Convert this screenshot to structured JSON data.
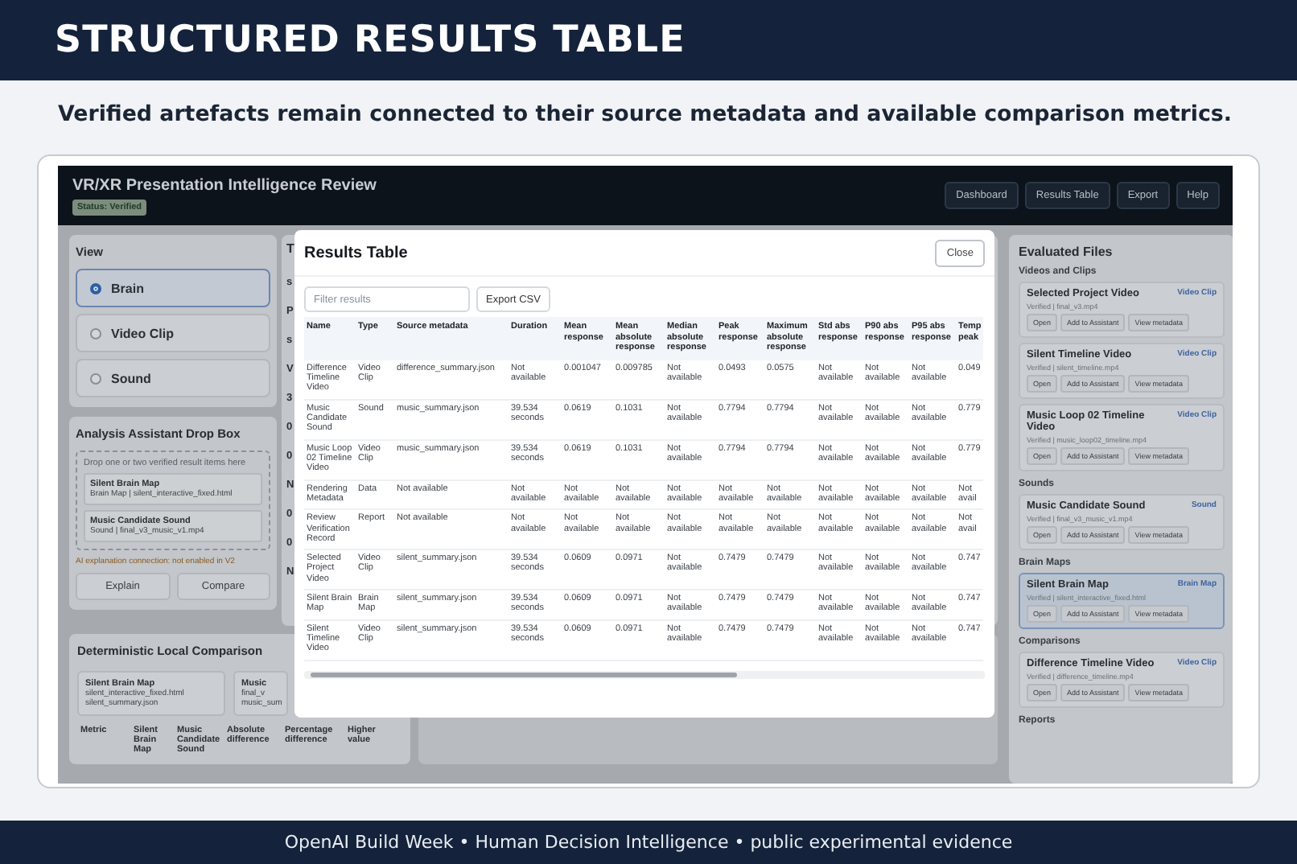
{
  "header": {
    "title": "STRUCTURED RESULTS TABLE"
  },
  "subtitle": "Verified artefacts remain connected to their source metadata and available comparison metrics.",
  "app": {
    "title": "VR/XR Presentation Intelligence Review",
    "status": "Status: Verified",
    "nav": [
      "Dashboard",
      "Results Table",
      "Export",
      "Help"
    ]
  },
  "view_panel": {
    "title": "View",
    "options": [
      {
        "label": "Brain",
        "selected": true
      },
      {
        "label": "Video Clip",
        "selected": false
      },
      {
        "label": "Sound",
        "selected": false
      }
    ]
  },
  "assistant": {
    "title": "Analysis Assistant Drop Box",
    "hint": "Drop one or two verified result items here",
    "items": [
      {
        "name": "Silent Brain Map",
        "detail": "Brain Map | silent_interactive_fixed.html"
      },
      {
        "name": "Music Candidate Sound",
        "detail": "Sound | final_v3_music_v1.mp4"
      }
    ],
    "notice": "AI explanation connection: not enabled in V2",
    "buttons": [
      "Explain",
      "Compare"
    ]
  },
  "comparison": {
    "title": "Deterministic Local Comparison",
    "cards": [
      {
        "name": "Silent Brain Map",
        "lines": [
          "silent_interactive_fixed.html",
          "silent_summary.json"
        ]
      },
      {
        "name": "Music",
        "lines": [
          "final_v",
          "music_sum"
        ]
      }
    ],
    "columns": [
      "Metric",
      "Silent Brain Map",
      "Music Candidate Sound",
      "Absolute difference",
      "Percentage difference",
      "Higher value"
    ]
  },
  "middle_panel": {
    "title": "T",
    "values": [
      "s",
      "P",
      "s",
      "V",
      "3",
      "0",
      "0",
      "N",
      "0",
      "0",
      "N"
    ]
  },
  "modal": {
    "title": "Results Table",
    "close": "Close",
    "filter": {
      "placeholder": "Filter results"
    },
    "export": "Export CSV",
    "columns": [
      "Name",
      "Type",
      "Source metadata",
      "Duration",
      "Mean response",
      "Mean absolute response",
      "Median absolute response",
      "Peak response",
      "Maximum absolute response",
      "Std abs response",
      "P90 abs response",
      "P95 abs response",
      "Temp peak"
    ],
    "rows": [
      [
        "Difference Timeline Video",
        "Video Clip",
        "difference_summary.json",
        "Not available",
        "0.001047",
        "0.009785",
        "Not available",
        "0.0493",
        "0.0575",
        "Not available",
        "Not available",
        "Not available",
        "0.049"
      ],
      [
        "Music Candidate Sound",
        "Sound",
        "music_summary.json",
        "39.534 seconds",
        "0.0619",
        "0.1031",
        "Not available",
        "0.7794",
        "0.7794",
        "Not available",
        "Not available",
        "Not available",
        "0.779"
      ],
      [
        "Music Loop 02 Timeline Video",
        "Video Clip",
        "music_summary.json",
        "39.534 seconds",
        "0.0619",
        "0.1031",
        "Not available",
        "0.7794",
        "0.7794",
        "Not available",
        "Not available",
        "Not available",
        "0.779"
      ],
      [
        "Rendering Metadata",
        "Data",
        "Not available",
        "Not available",
        "Not available",
        "Not available",
        "Not available",
        "Not available",
        "Not available",
        "Not available",
        "Not available",
        "Not available",
        "Not avail"
      ],
      [
        "Review Verification Record",
        "Report",
        "Not available",
        "Not available",
        "Not available",
        "Not available",
        "Not available",
        "Not available",
        "Not available",
        "Not available",
        "Not available",
        "Not available",
        "Not avail"
      ],
      [
        "Selected Project Video",
        "Video Clip",
        "silent_summary.json",
        "39.534 seconds",
        "0.0609",
        "0.0971",
        "Not available",
        "0.7479",
        "0.7479",
        "Not available",
        "Not available",
        "Not available",
        "0.747"
      ],
      [
        "Silent Brain Map",
        "Brain Map",
        "silent_summary.json",
        "39.534 seconds",
        "0.0609",
        "0.0971",
        "Not available",
        "0.7479",
        "0.7479",
        "Not available",
        "Not available",
        "Not available",
        "0.747"
      ],
      [
        "Silent Timeline Video",
        "Video Clip",
        "silent_summary.json",
        "39.534 seconds",
        "0.0609",
        "0.0971",
        "Not available",
        "0.7479",
        "0.7479",
        "Not available",
        "Not available",
        "Not available",
        "0.747"
      ]
    ]
  },
  "files": {
    "title": "Evaluated Files",
    "groups": [
      {
        "label": "Videos and Clips",
        "items": [
          {
            "name": "Selected Project Video",
            "tag": "Video Clip",
            "detail": "Verified | final_v3.mp4",
            "selected": false,
            "actions": [
              "Open",
              "Add to Assistant",
              "View metadata"
            ]
          },
          {
            "name": "Silent Timeline Video",
            "tag": "Video Clip",
            "detail": "Verified | silent_timeline.mp4",
            "selected": false,
            "actions": [
              "Open",
              "Add to Assistant",
              "View metadata"
            ]
          },
          {
            "name": "Music Loop 02 Timeline Video",
            "tag": "Video Clip",
            "detail": "Verified | music_loop02_timeline.mp4",
            "selected": false,
            "actions": [
              "Open",
              "Add to Assistant",
              "View metadata"
            ]
          }
        ]
      },
      {
        "label": "Sounds",
        "items": [
          {
            "name": "Music Candidate Sound",
            "tag": "Sound",
            "detail": "Verified | final_v3_music_v1.mp4",
            "selected": false,
            "actions": [
              "Open",
              "Add to Assistant",
              "View metadata"
            ]
          }
        ]
      },
      {
        "label": "Brain Maps",
        "items": [
          {
            "name": "Silent Brain Map",
            "tag": "Brain Map",
            "detail": "Verified | silent_interactive_fixed.html",
            "selected": true,
            "actions": [
              "Open",
              "Add to Assistant",
              "View metadata"
            ]
          }
        ]
      },
      {
        "label": "Comparisons",
        "items": [
          {
            "name": "Difference Timeline Video",
            "tag": "Video Clip",
            "detail": "Verified | difference_timeline.mp4",
            "selected": false,
            "actions": [
              "Open",
              "Add to Assistant",
              "View metadata"
            ]
          }
        ]
      },
      {
        "label": "Reports"
      }
    ]
  },
  "footer": "OpenAI Build Week • Human Decision Intelligence • public experimental evidence"
}
